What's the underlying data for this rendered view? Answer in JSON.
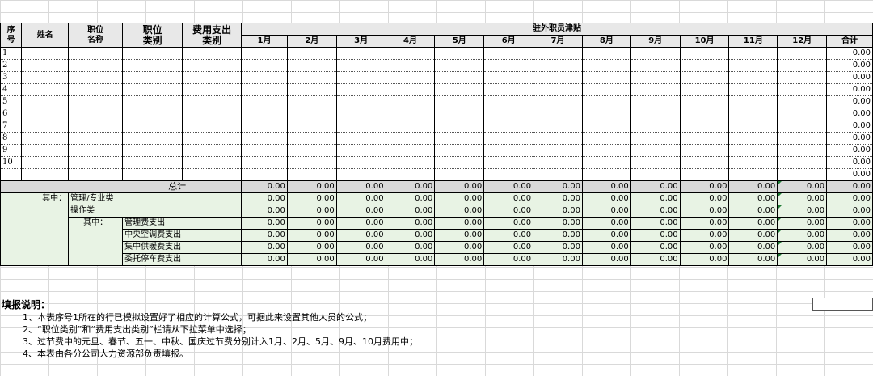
{
  "headers": {
    "seq": "序\n号",
    "name": "姓名",
    "pos_name": "职位\n名称",
    "pos_type": "职位\n类别",
    "expense_type": "费用支出\n类别",
    "group": "驻外职员津贴",
    "months": [
      "1月",
      "2月",
      "3月",
      "4月",
      "5月",
      "6月",
      "7月",
      "8月",
      "9月",
      "10月",
      "11月",
      "12月"
    ],
    "sum": "合计"
  },
  "rows": [
    {
      "seq": "1",
      "sum": "0.00"
    },
    {
      "seq": "2",
      "sum": "0.00"
    },
    {
      "seq": "3",
      "sum": "0.00"
    },
    {
      "seq": "4",
      "sum": "0.00"
    },
    {
      "seq": "5",
      "sum": "0.00"
    },
    {
      "seq": "6",
      "sum": "0.00"
    },
    {
      "seq": "7",
      "sum": "0.00"
    },
    {
      "seq": "8",
      "sum": "0.00"
    },
    {
      "seq": "9",
      "sum": "0.00"
    },
    {
      "seq": "10",
      "sum": "0.00"
    },
    {
      "seq": "",
      "sum": "0.00"
    }
  ],
  "total": {
    "label": "总计",
    "value": "0.00"
  },
  "breakdown": {
    "qizhong": "其中：",
    "mgmt": "管理/专业类",
    "ops": "操作类",
    "qizhong2": "其中：",
    "items": [
      "管理费支出",
      "中央空调费支出",
      "集中供暖费支出",
      "委托停车费支出"
    ]
  },
  "zero": "0.00",
  "notes": {
    "title": "填报说明：",
    "items": [
      "1、本表序号1所在的行已模拟设置好了相应的计算公式，可据此来设置其他人员的公式；",
      "2、“职位类别”和“费用支出类别”栏请从下拉菜单中选择；",
      "3、过节费中的元旦、春节、五一、中秋、国庆过节费分别计入1月、2月、5月、9月、10月费用中；",
      "4、本表由各分公司人力资源部负责填报。"
    ]
  }
}
